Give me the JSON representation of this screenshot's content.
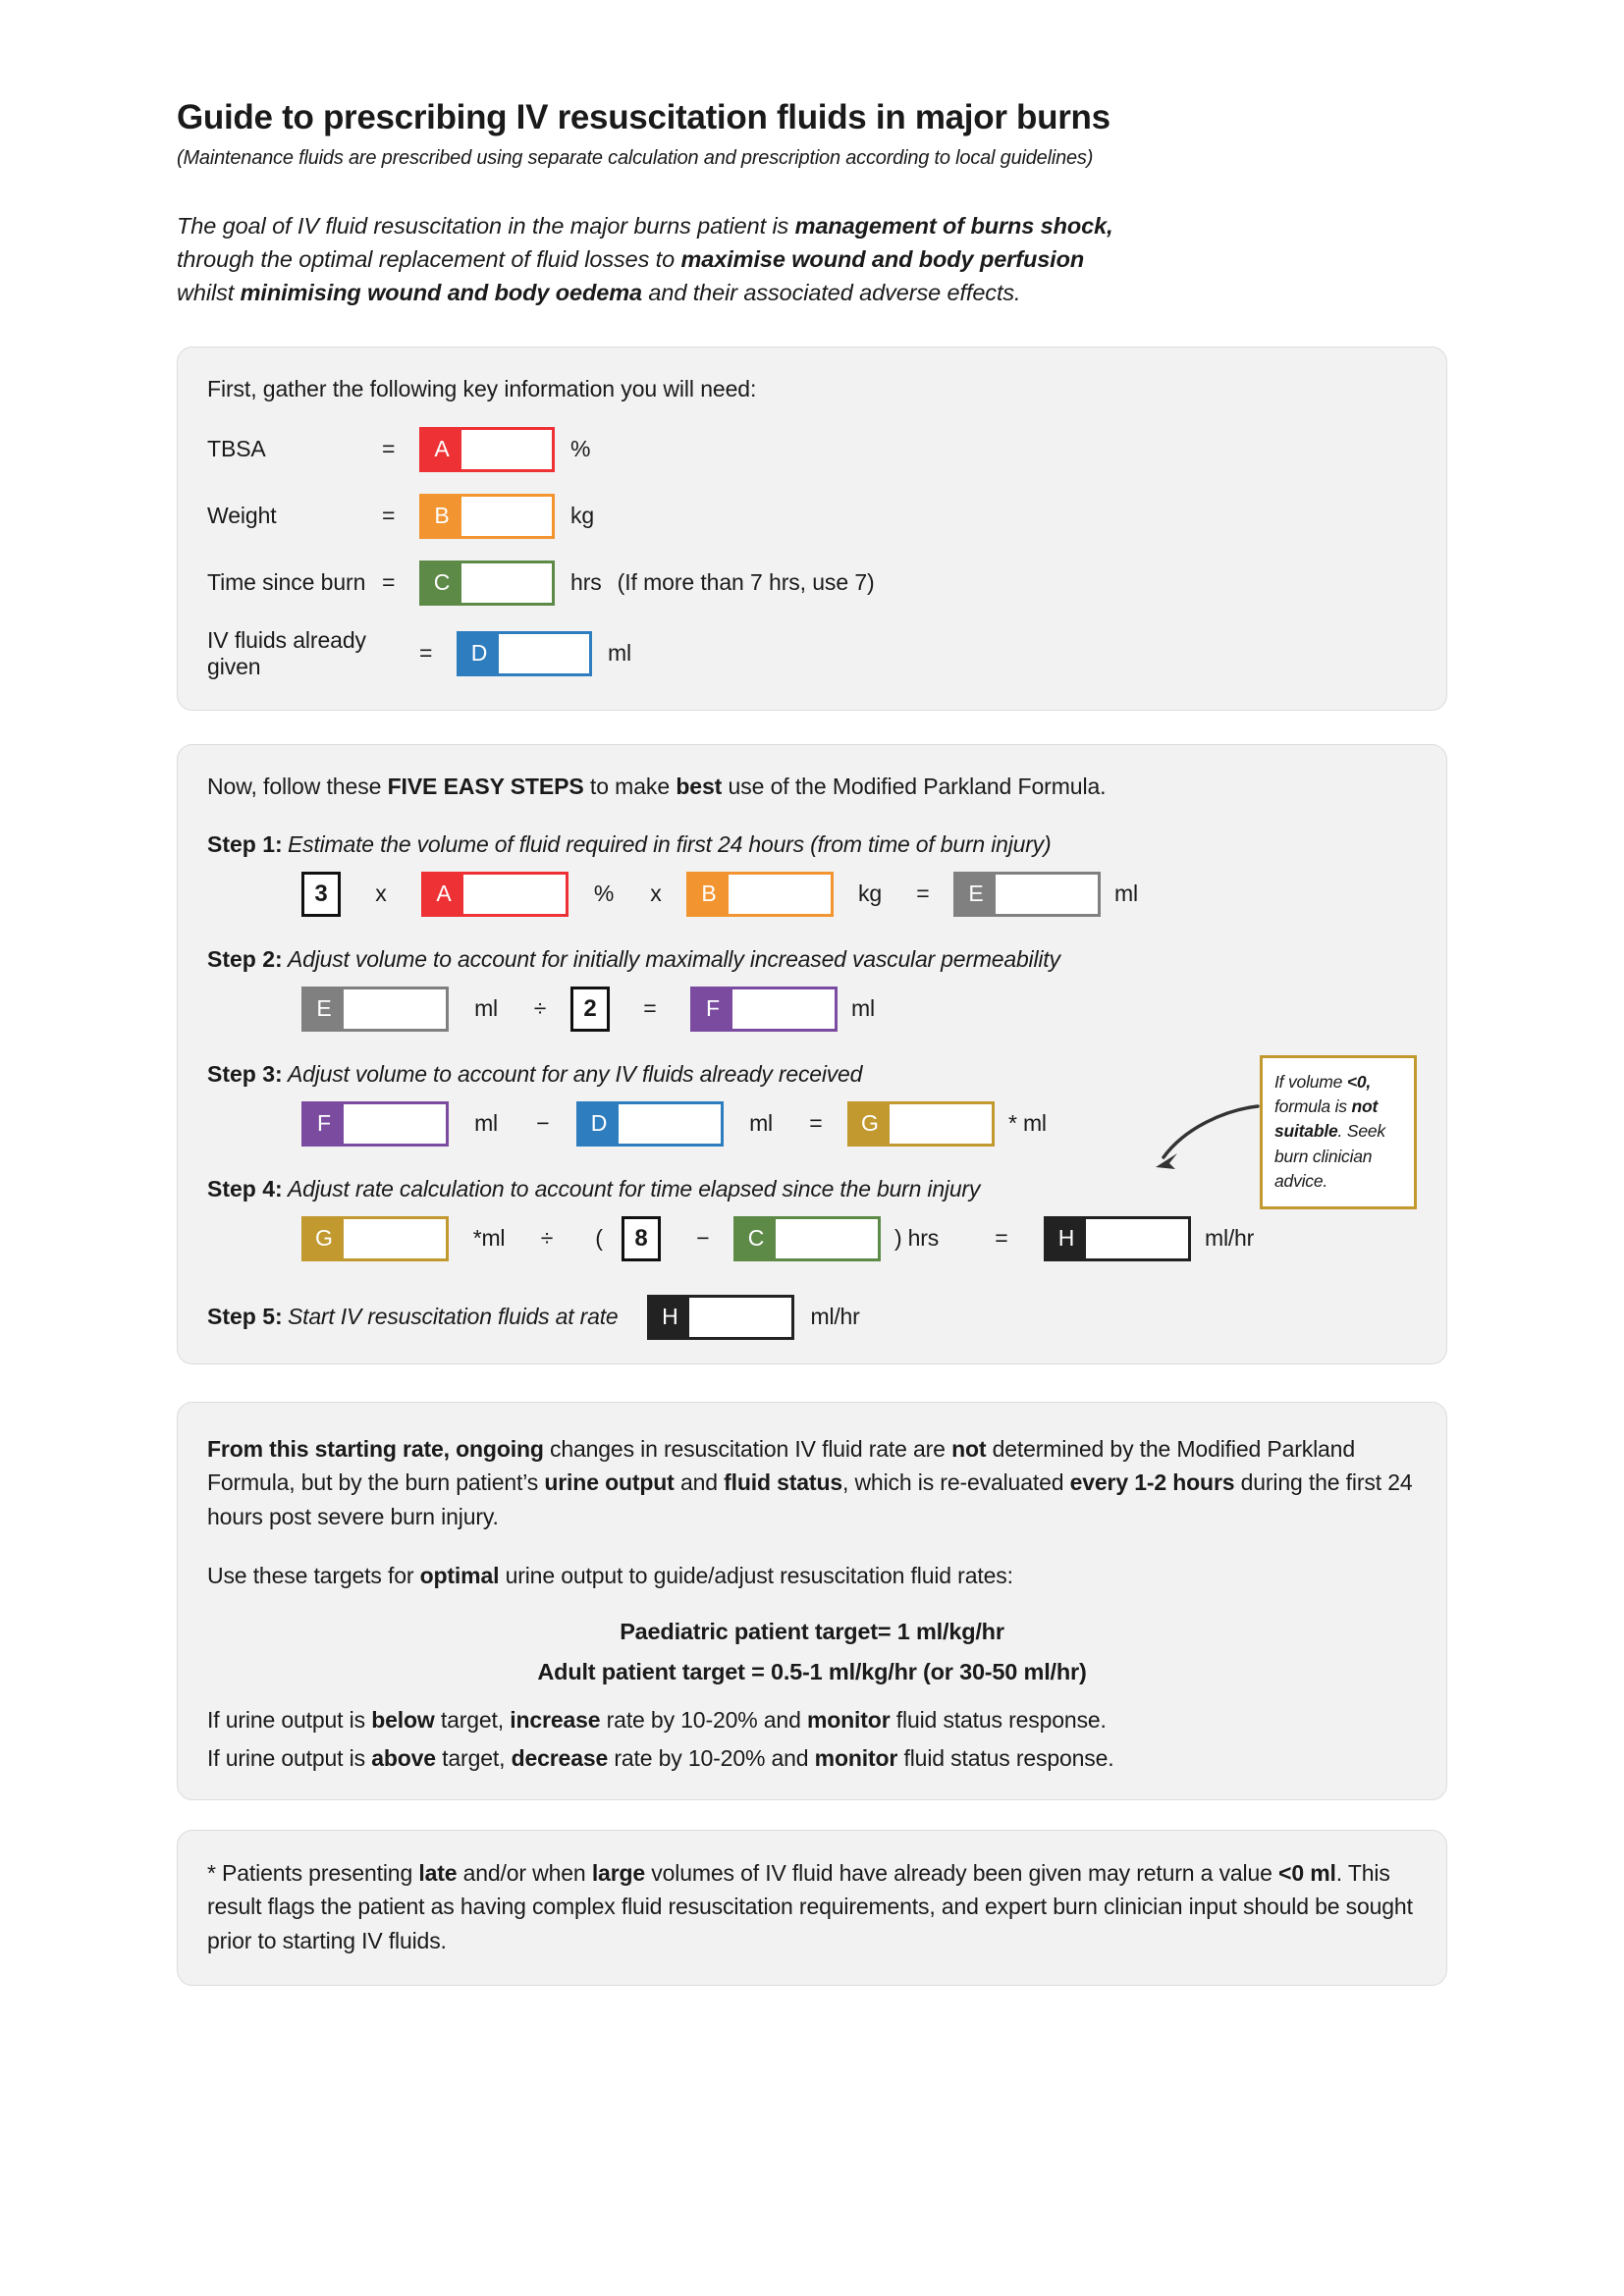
{
  "document": {
    "title": "Guide to prescribing IV resuscitation fluids in major burns",
    "subtitle": "(Maintenance fluids are prescribed using separate calculation and prescription according to local guidelines)"
  },
  "intro": {
    "line1_a": "The goal of IV fluid resuscitation in the major burns patient is ",
    "line1_b": "management of burns shock,",
    "line2_a": "through the optimal replacement of fluid losses to ",
    "line2_b": "maximise wound and body perfusion",
    "line3_a": "whilst ",
    "line3_b": "minimising wound and body oedema",
    "line3_c": " and their associated adverse effects."
  },
  "gather": {
    "lead": "First, gather the following key information you will need:",
    "rows": [
      {
        "label": "TBSA",
        "equals": "=",
        "tag": "A",
        "value": "",
        "unit": "%",
        "note": ""
      },
      {
        "label": "Weight",
        "equals": "=",
        "tag": "B",
        "value": "",
        "unit": "kg",
        "note": ""
      },
      {
        "label": "Time since burn",
        "equals": "=",
        "tag": "C",
        "value": "",
        "unit": "hrs",
        "note": "(If more than 7 hrs, use 7)"
      },
      {
        "label": "IV fluids already given",
        "equals": "=",
        "tag": "D",
        "value": "",
        "unit": "ml",
        "note": ""
      }
    ]
  },
  "steps": {
    "lead_a": "Now, follow these ",
    "lead_b": "FIVE EASY STEPS",
    "lead_c": " to make ",
    "lead_d": "best",
    "lead_e": " use of the Modified Parkland Formula.",
    "step1": {
      "num": "Step 1:",
      "desc": "Estimate the volume of fluid required in first 24 hours (from time of burn injury)",
      "const": "3",
      "op1": "x",
      "tagA": "A",
      "unitA": "%",
      "op2": "x",
      "tagB": "B",
      "unitB": "kg",
      "op3": "=",
      "tagE": "E",
      "unitE": "ml"
    },
    "step2": {
      "num": "Step 2:",
      "desc": "Adjust volume to account for initially maximally increased vascular permeability",
      "tagE": "E",
      "unitE": "ml",
      "op1": "÷",
      "const": "2",
      "op2": "=",
      "tagF": "F",
      "unitF": "ml"
    },
    "step3": {
      "num": "Step 3:",
      "desc": "Adjust volume to account for any IV fluids already received",
      "tagF": "F",
      "unitF": "ml",
      "op1": "−",
      "tagD": "D",
      "unitD": "ml",
      "op2": "=",
      "tagG": "G",
      "unitG": "* ml"
    },
    "step4": {
      "num": "Step 4:",
      "desc": "Adjust rate calculation to account for time elapsed since the burn injury",
      "tagG": "G",
      "unitG": "*ml",
      "op1": "÷",
      "paren_open": "(",
      "const": "8",
      "op2": "−",
      "tagC": "C",
      "paren_close": ") hrs",
      "op3": "=",
      "tagH": "H",
      "unitH": "ml/hr"
    },
    "step5": {
      "num": "Step 5:",
      "desc": "Start IV resuscitation fluids at rate",
      "tagH": "H",
      "unitH": "ml/hr"
    },
    "callout": {
      "a": "If volume ",
      "b": "<0,",
      "c": " formula is ",
      "d": "not suitable",
      "e": ". Seek burn clinician advice."
    }
  },
  "ongoing": {
    "p1_a": "From this starting rate, ongoing",
    "p1_b": " changes in resuscitation IV fluid rate are ",
    "p1_c": "not",
    "p1_d": " determined by the Modified Parkland Formula, but by the burn patient’s ",
    "p1_e": "urine output",
    "p1_f": " and ",
    "p1_g": "fluid status",
    "p1_h": ", which is re-evaluated ",
    "p1_i": "every 1-2 hours",
    "p1_j": " during the first 24 hours post severe burn injury.",
    "p2_a": "Use these targets for ",
    "p2_b": "optimal",
    "p2_c": " urine output to guide/adjust resuscitation fluid rates:",
    "target_paediatric": "Paediatric patient target= 1 ml/kg/hr",
    "target_adult": "Adult patient target = 0.5-1 ml/kg/hr (or 30-50 ml/hr)",
    "below_a": "If urine output is ",
    "below_b": "below",
    "below_c": " target, ",
    "below_d": "increase",
    "below_e": " rate by 10-20% and ",
    "below_f": "monitor",
    "below_g": " fluid status response.",
    "above_a": "If urine output is ",
    "above_b": "above",
    "above_c": " target, ",
    "above_d": "decrease",
    "above_e": " rate by 10-20% and ",
    "above_f": "monitor",
    "above_g": " fluid status response."
  },
  "footnote": {
    "a": "* Patients presenting ",
    "b": "late",
    "c": " and/or when ",
    "d": "large",
    "e": " volumes of IV fluid have already been given may return a value ",
    "f": "<0 ml",
    "g": ". This result flags the patient as having complex fluid resuscitation requirements, and expert burn clinician input should be sought prior to starting IV fluids."
  },
  "colors": {
    "A": "#ee3134",
    "B": "#f2942f",
    "C": "#5e8a48",
    "D": "#2e7ebf",
    "E": "#808080",
    "F": "#7b4ba0",
    "G": "#c2992f",
    "H": "#222222",
    "panel_bg": "#f2f2f2"
  }
}
